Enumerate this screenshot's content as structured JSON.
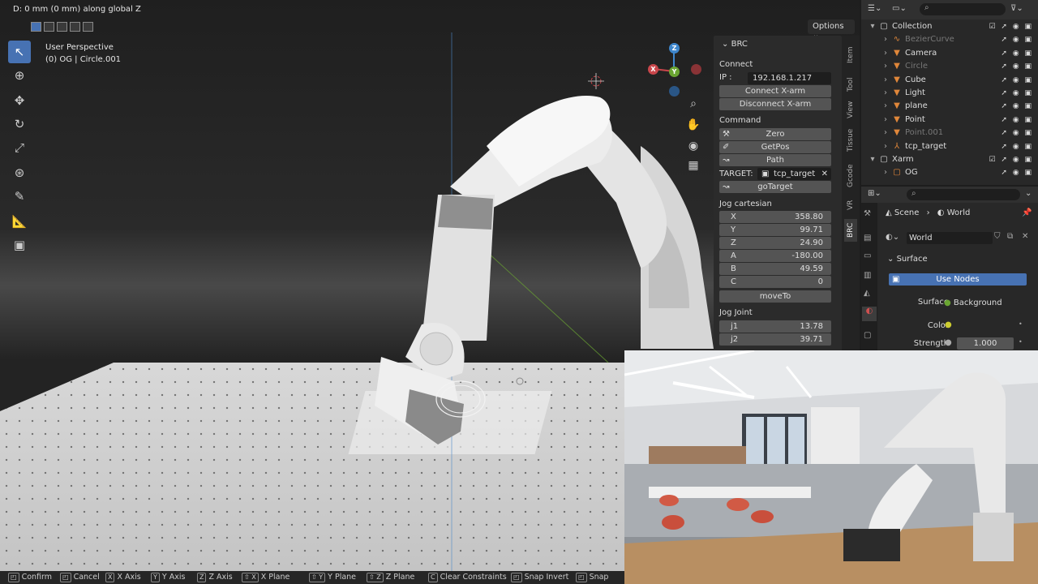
{
  "header_text": "D: 0 mm (0 mm) along global Z",
  "options_label": "Options",
  "viewport": {
    "title": "User Perspective",
    "subtitle": "(0) OG | Circle.001"
  },
  "tools": [
    {
      "name": "select-box-icon",
      "glyph": "↖",
      "active": true
    },
    {
      "name": "cursor-icon",
      "glyph": "⊕"
    },
    {
      "name": "move-icon",
      "glyph": "✥"
    },
    {
      "name": "rotate-icon",
      "glyph": "↻"
    },
    {
      "name": "scale-icon",
      "glyph": "⤢"
    },
    {
      "name": "transform-icon",
      "glyph": "⊛"
    },
    {
      "name": "annotate-icon",
      "glyph": "✎"
    },
    {
      "name": "measure-icon",
      "glyph": "📐"
    },
    {
      "name": "add-cube-icon",
      "glyph": "▣"
    }
  ],
  "gizmo": {
    "x": "X",
    "y": "Y",
    "z": "Z"
  },
  "brc": {
    "title": "BRC",
    "connect_section": "Connect",
    "ip_label": "IP :",
    "ip_value": "192.168.1.217",
    "connect_button": "Connect X-arm",
    "disconnect_button": "Disconnect X-arm",
    "command_section": "Command",
    "zero_button": "Zero",
    "getpos_button": "GetPos",
    "path_button": "Path",
    "target_label": "TARGET:",
    "target_value": "tcp_target",
    "gotarget_button": "goTarget",
    "jog_cartesian_section": "Jog cartesian",
    "cartesian": [
      {
        "label": "X",
        "value": "358.80"
      },
      {
        "label": "Y",
        "value": "99.71"
      },
      {
        "label": "Z",
        "value": "24.90"
      },
      {
        "label": "A",
        "value": "-180.00"
      },
      {
        "label": "B",
        "value": "49.59"
      },
      {
        "label": "C",
        "value": "0"
      }
    ],
    "moveto_button": "moveTo",
    "jog_joint_section": "Jog Joint",
    "joints": [
      {
        "label": "j1",
        "value": "13.78"
      },
      {
        "label": "j2",
        "value": "39.71"
      }
    ]
  },
  "side_tabs": [
    "Item",
    "Tool",
    "View",
    "Tissue",
    "Gcode",
    "VR",
    "BRC"
  ],
  "outliner": {
    "items": [
      {
        "label": "Collection",
        "indent": 1,
        "icon": "▢",
        "dim": false
      },
      {
        "label": "BezierCurve",
        "indent": 2,
        "icon": "∿",
        "dim": true
      },
      {
        "label": "Camera",
        "indent": 2,
        "icon": "▼",
        "dim": false
      },
      {
        "label": "Circle",
        "indent": 2,
        "icon": "▼",
        "dim": true
      },
      {
        "label": "Cube",
        "indent": 2,
        "icon": "▼",
        "dim": false
      },
      {
        "label": "Light",
        "indent": 2,
        "icon": "▼",
        "dim": false
      },
      {
        "label": "plane",
        "indent": 2,
        "icon": "▼",
        "dim": false
      },
      {
        "label": "Point",
        "indent": 2,
        "icon": "▼",
        "dim": false
      },
      {
        "label": "Point.001",
        "indent": 2,
        "icon": "▼",
        "dim": true
      },
      {
        "label": "tcp_target",
        "indent": 2,
        "icon": "⅄",
        "dim": false
      },
      {
        "label": "Xarm",
        "indent": 1,
        "icon": "▢",
        "dim": false
      },
      {
        "label": "OG",
        "indent": 2,
        "icon": "▢",
        "dim": false
      }
    ]
  },
  "properties": {
    "breadcrumb_scene": "Scene",
    "breadcrumb_world": "World",
    "world_name": "World",
    "surface_section": "Surface",
    "use_nodes_button": "Use Nodes",
    "surface_label": "Surface",
    "surface_value": "Background",
    "color_label": "Color",
    "strength_label": "Strength",
    "strength_value": "1.000"
  },
  "statusbar": [
    {
      "key": "",
      "label": "Confirm"
    },
    {
      "key": "",
      "label": "Cancel"
    },
    {
      "key": "X",
      "label": "X Axis"
    },
    {
      "key": "Y",
      "label": "Y Axis"
    },
    {
      "key": "Z",
      "label": "Z Axis"
    },
    {
      "key": "⇧ X",
      "label": "X Plane"
    },
    {
      "key": "⇧ Y",
      "label": "Y Plane"
    },
    {
      "key": "⇧ Z",
      "label": "Z Plane"
    },
    {
      "key": "C",
      "label": "Clear Constraints"
    },
    {
      "key": "",
      "label": "Snap Invert"
    },
    {
      "key": "",
      "label": "Snap"
    }
  ],
  "colors": {
    "accent": "#4772b3",
    "x_axis": "#c9464b",
    "y_axis": "#6aa532",
    "z_axis": "#3e86cc",
    "orange": "#e0873a"
  }
}
